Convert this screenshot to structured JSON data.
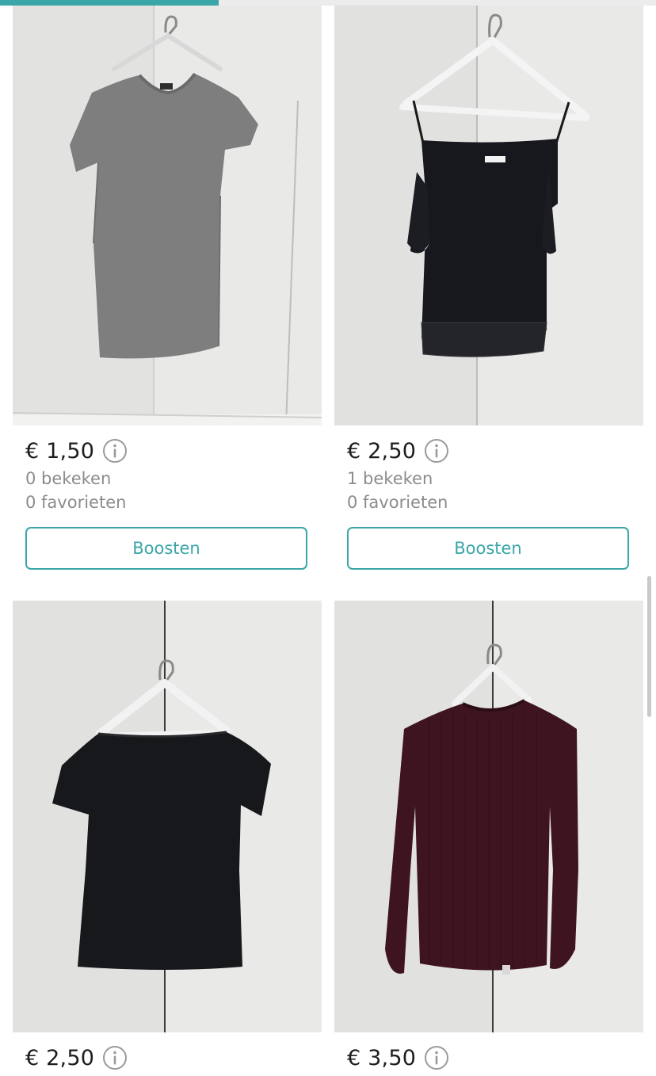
{
  "upload_progress": {
    "fraction": 0.333
  },
  "colors": {
    "accent": "#3aa6a8",
    "price_text": "#1d1d1d",
    "stat_text": "#8c8c8c"
  },
  "items": [
    {
      "price": "€ 1,50",
      "views": "0 bekeken",
      "favorites": "0 favorieten",
      "boost_label": "Boosten",
      "photo": "grey-tshirt-dress-on-hanger",
      "info_icon": "info-icon"
    },
    {
      "price": "€ 2,50",
      "views": "1 bekeken",
      "favorites": "0 favorieten",
      "boost_label": "Boosten",
      "photo": "black-cold-shoulder-top-on-hanger",
      "info_icon": "info-icon"
    },
    {
      "price": "€ 2,50",
      "photo": "black-off-shoulder-tshirt-on-hanger",
      "info_icon": "info-icon"
    },
    {
      "price": "€ 3,50",
      "photo": "burgundy-ribbed-sweater-on-hanger",
      "info_icon": "info-icon"
    }
  ]
}
